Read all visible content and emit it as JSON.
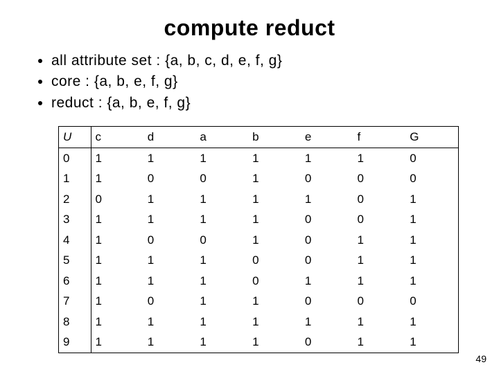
{
  "title": "compute reduct",
  "bullets": [
    "all attribute set : {a, b, c, d, e, f, g}",
    "core : {a, b, e, f, g}",
    "reduct : {a, b, e, f, g}"
  ],
  "table": {
    "headers": [
      "U",
      "c",
      "d",
      "a",
      "b",
      "e",
      "f",
      "G"
    ],
    "rows": [
      [
        "0",
        "1",
        "1",
        "1",
        "1",
        "1",
        "1",
        "0"
      ],
      [
        "1",
        "1",
        "0",
        "0",
        "1",
        "0",
        "0",
        "0"
      ],
      [
        "2",
        "0",
        "1",
        "1",
        "1",
        "1",
        "0",
        "1"
      ],
      [
        "3",
        "1",
        "1",
        "1",
        "1",
        "0",
        "0",
        "1"
      ],
      [
        "4",
        "1",
        "0",
        "0",
        "1",
        "0",
        "1",
        "1"
      ],
      [
        "5",
        "1",
        "1",
        "1",
        "0",
        "0",
        "1",
        "1"
      ],
      [
        "6",
        "1",
        "1",
        "1",
        "0",
        "1",
        "1",
        "1"
      ],
      [
        "7",
        "1",
        "0",
        "1",
        "1",
        "0",
        "0",
        "0"
      ],
      [
        "8",
        "1",
        "1",
        "1",
        "1",
        "1",
        "1",
        "1"
      ],
      [
        "9",
        "1",
        "1",
        "1",
        "1",
        "0",
        "1",
        "1"
      ]
    ]
  },
  "page_number": "49"
}
